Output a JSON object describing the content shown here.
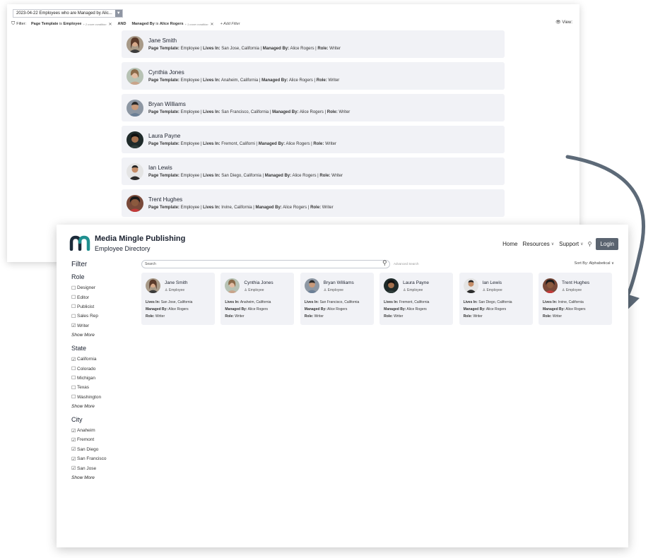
{
  "back_window": {
    "view_name": "2023-04-22 Employees who are Managed by Alic...",
    "filter_label": "Filter:",
    "chips": [
      {
        "field": "Page Template",
        "op": "is",
        "value": "Employee",
        "more": "+ 2 more condition"
      },
      {
        "field": "Managed By",
        "op": "is",
        "value": "Alice Rogers",
        "more": "+ 1 more condition"
      }
    ],
    "and_label": "AND",
    "add_filter": "+ Add Filter",
    "view_label": "View:",
    "rows": [
      {
        "name": "Jane Smith",
        "template": "Employee",
        "lives_in": "San Jose, California",
        "managed_by": "Alice Rogers",
        "role": "Writer"
      },
      {
        "name": "Cynthia Jones",
        "template": "Employee",
        "lives_in": "Anaheim, California",
        "managed_by": "Alice Rogers",
        "role": "Writer"
      },
      {
        "name": "Bryan Williams",
        "template": "Employee",
        "lives_in": "San Francisco, California",
        "managed_by": "Alice Rogers",
        "role": "Writer"
      },
      {
        "name": "Laura Payne",
        "template": "Employee",
        "lives_in": "Fremont, Californi",
        "managed_by": "Alice Rogers",
        "role": "Writer"
      },
      {
        "name": "Ian Lewis",
        "template": "Employee",
        "lives_in": "San Diego, California",
        "managed_by": "Alice Rogers",
        "role": "Writer"
      },
      {
        "name": "Trent Hughes",
        "template": "Employee",
        "lives_in": "Irvine, California",
        "managed_by": "Alice Rogers",
        "role": "Writer"
      }
    ],
    "labels": {
      "template": "Page Template:",
      "lives_in": "Lives In:",
      "managed_by": "Managed By:",
      "role": "Role:"
    }
  },
  "site": {
    "brand": "Media Mingle Publishing",
    "subtitle": "Employee Directory",
    "nav": {
      "home": "Home",
      "resources": "Resources",
      "support": "Support",
      "login": "Login"
    },
    "filter_title": "Filter",
    "show_more": "Show More",
    "groups": [
      {
        "title": "Role",
        "options": [
          {
            "label": "Designer",
            "checked": false
          },
          {
            "label": "Editor",
            "checked": false
          },
          {
            "label": "Publicist",
            "checked": false
          },
          {
            "label": "Sales Rep",
            "checked": false
          },
          {
            "label": "Writer",
            "checked": true
          }
        ]
      },
      {
        "title": "State",
        "options": [
          {
            "label": "California",
            "checked": true
          },
          {
            "label": "Colorado",
            "checked": false
          },
          {
            "label": "Michigan",
            "checked": false
          },
          {
            "label": "Texas",
            "checked": false
          },
          {
            "label": "Washington",
            "checked": false
          }
        ]
      },
      {
        "title": "City",
        "options": [
          {
            "label": "Anaheim",
            "checked": true
          },
          {
            "label": "Fremont",
            "checked": true
          },
          {
            "label": "San Diego",
            "checked": true
          },
          {
            "label": "San Francisco",
            "checked": true
          },
          {
            "label": "San Jose",
            "checked": true
          }
        ]
      }
    ],
    "search_placeholder": "Search",
    "advanced_search": "Advanced Search",
    "sort": "Sort By: Alphabetical",
    "card_labels": {
      "lives_in": "Lives In:",
      "managed_by": "Managed By:",
      "role": "Role:"
    },
    "cards": [
      {
        "name": "Jane Smith",
        "kind": "Employee",
        "lives_in": "San Jose, California",
        "managed_by": "Alice Rogers",
        "role": "Writer"
      },
      {
        "name": "Cynthia Jones",
        "kind": "Employee",
        "lives_in": "Anaheim, California",
        "managed_by": "Alice Rogers",
        "role": "Writer"
      },
      {
        "name": "Bryan Williams",
        "kind": "Employee",
        "lives_in": "San Francisco, California",
        "managed_by": "Alice Rogers",
        "role": "Writer"
      },
      {
        "name": "Laura Payne",
        "kind": "Employee",
        "lives_in": "Fremont, California",
        "managed_by": "Alice Rogers",
        "role": "Writer"
      },
      {
        "name": "Ian Lewis",
        "kind": "Employee",
        "lives_in": "San Diego, California",
        "managed_by": "Alice Rogers",
        "role": "Writer"
      },
      {
        "name": "Trent Hughes",
        "kind": "Employee",
        "lives_in": "Irvine, California",
        "managed_by": "Alice Rogers",
        "role": "Writer"
      }
    ]
  },
  "colors": {
    "brand_teal": "#1f8f8f",
    "card_bg": "#f1f2f6",
    "arrow": "#5d6a78",
    "login_bg": "#5b6470"
  }
}
